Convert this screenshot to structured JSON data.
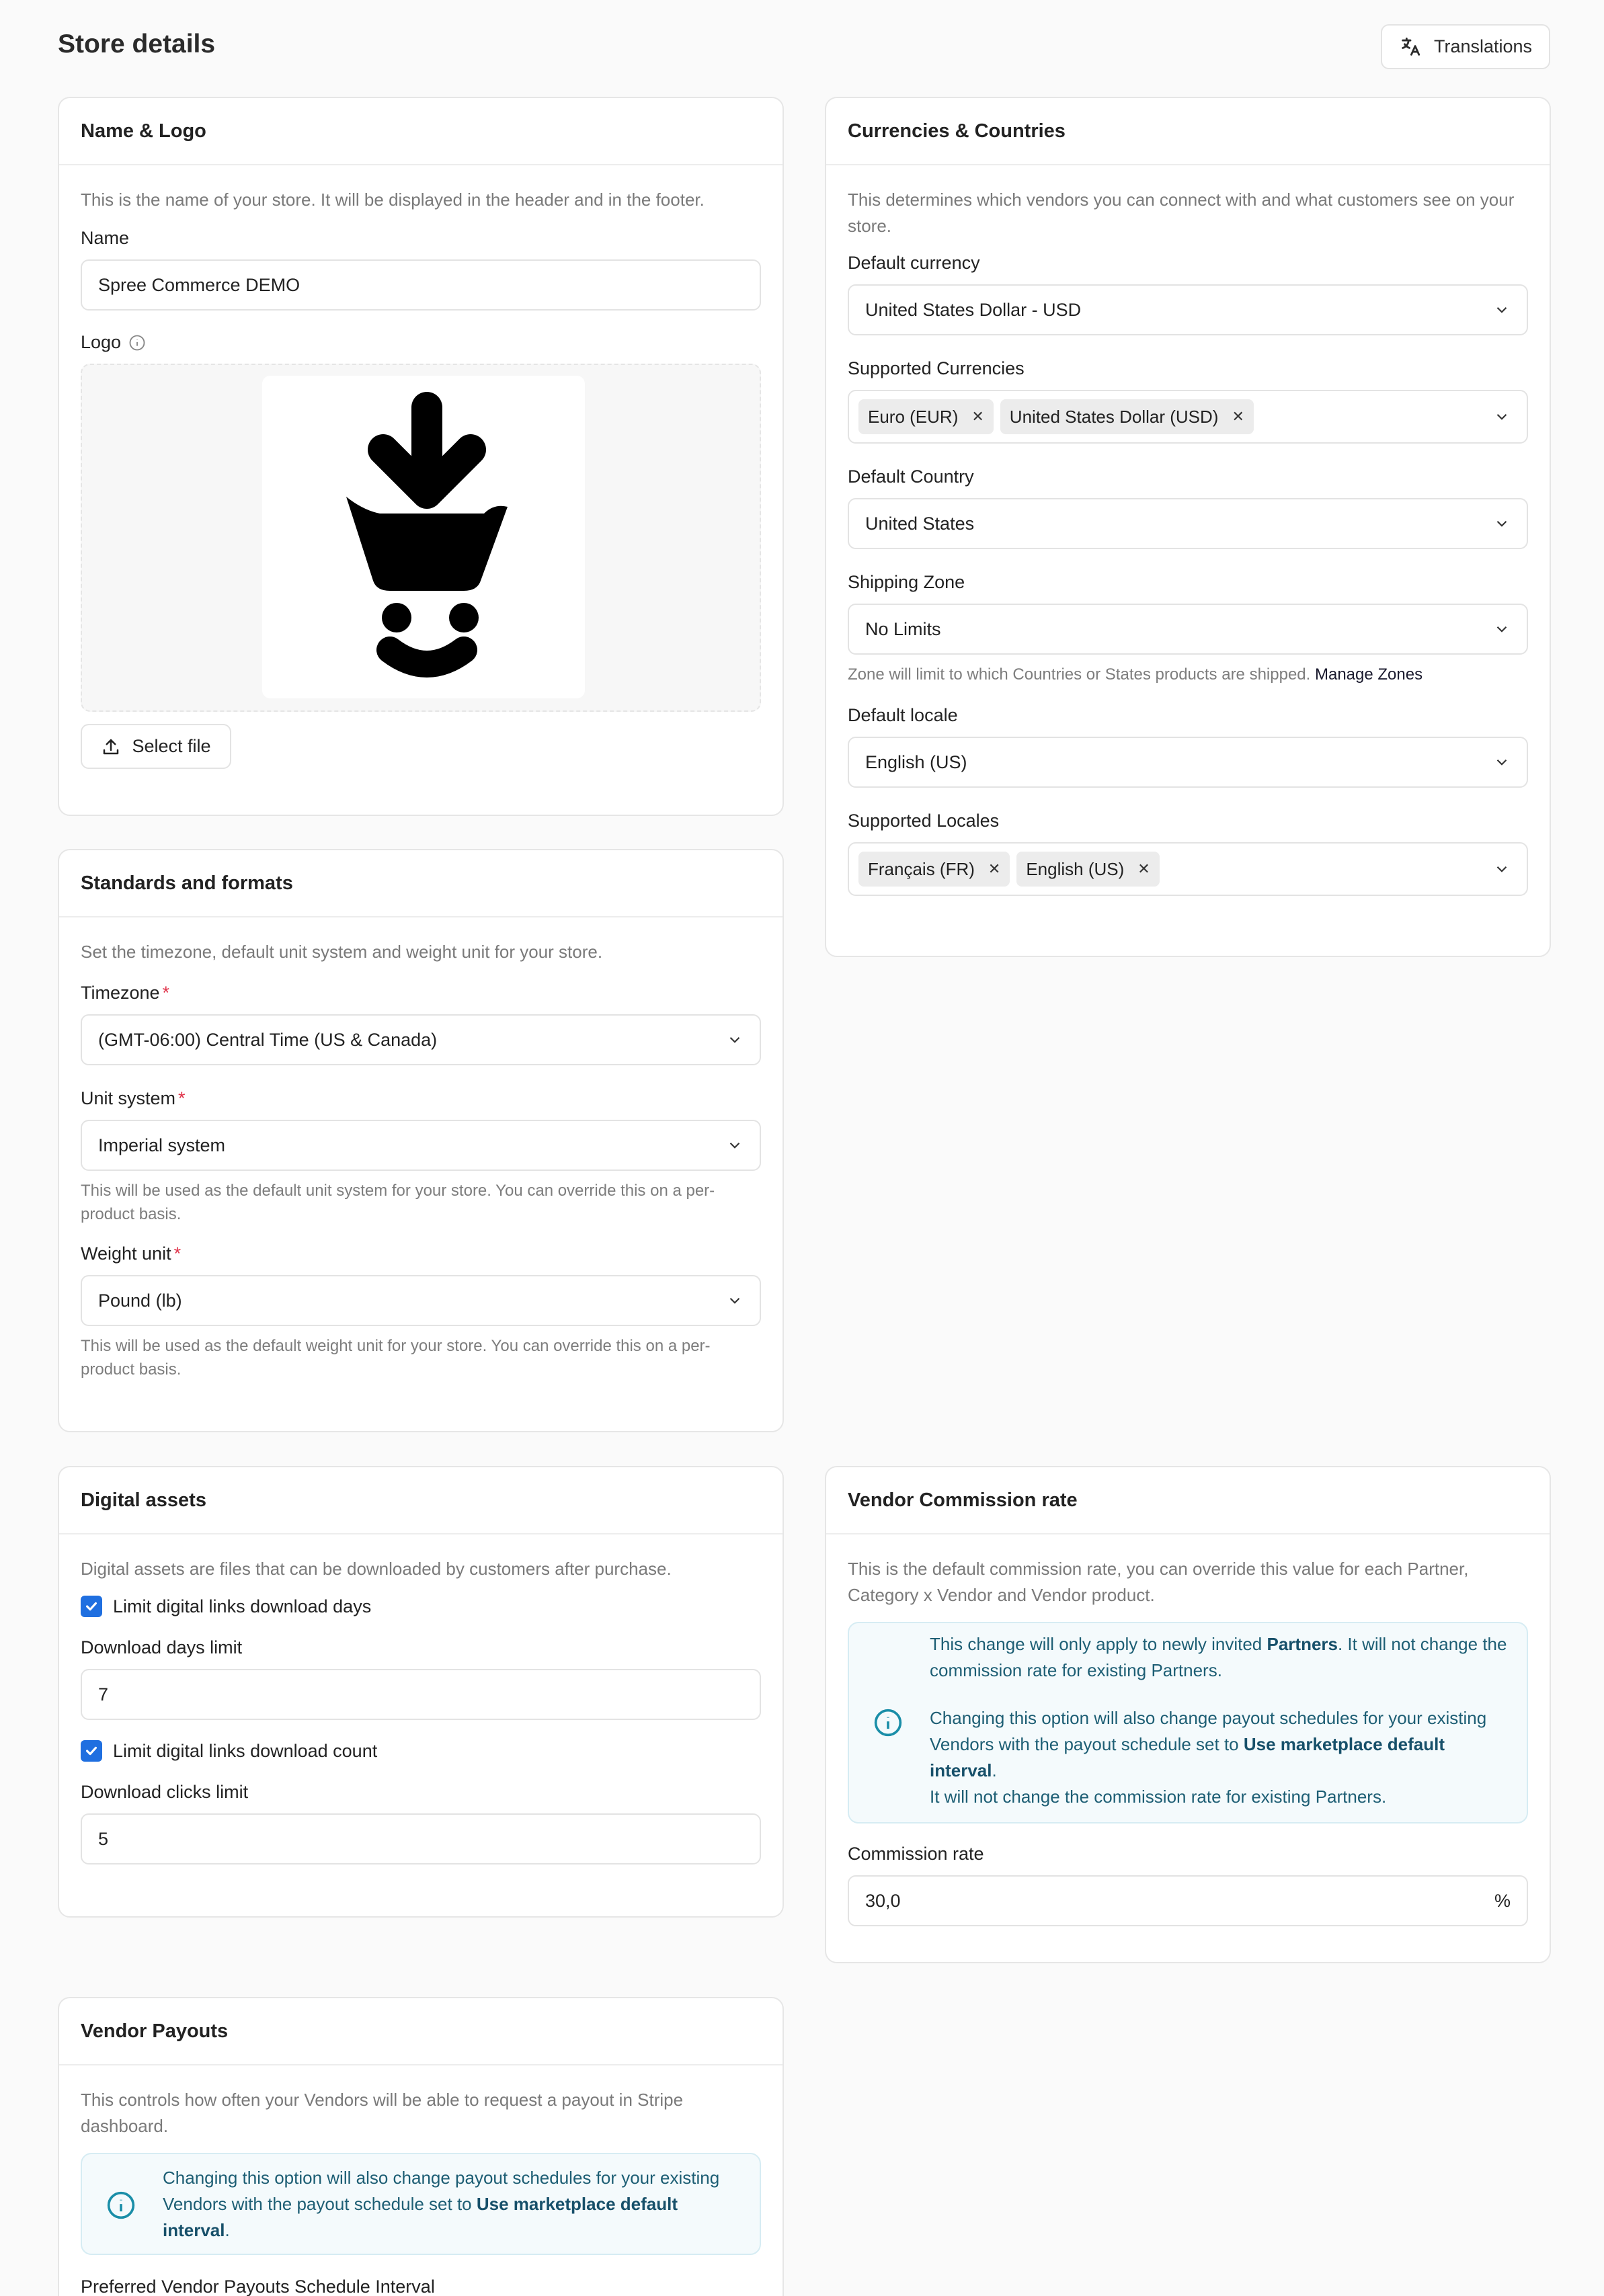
{
  "header": {
    "title": "Store details",
    "translations_label": "Translations"
  },
  "name_logo": {
    "title": "Name & Logo",
    "description": "This is the name of your store. It will be displayed in the header and in the footer.",
    "name_label": "Name",
    "name_value": "Spree Commerce DEMO",
    "logo_label": "Logo",
    "select_file_label": "Select file"
  },
  "currencies": {
    "title": "Currencies & Countries",
    "description": "This determines which vendors you can connect with and what customers see on your store.",
    "default_currency_label": "Default currency",
    "default_currency_value": "United States Dollar - USD",
    "supported_currencies_label": "Supported Currencies",
    "supported_currencies": [
      "Euro (EUR)",
      "United States Dollar (USD)"
    ],
    "default_country_label": "Default Country",
    "default_country_value": "United States",
    "shipping_zone_label": "Shipping Zone",
    "shipping_zone_value": "No Limits",
    "shipping_hint": "Zone will limit to which Countries or States products are shipped.",
    "manage_zones_label": "Manage Zones",
    "default_locale_label": "Default locale",
    "default_locale_value": "English (US)",
    "supported_locales_label": "Supported Locales",
    "supported_locales": [
      "Français (FR)",
      "English (US)"
    ]
  },
  "standards": {
    "title": "Standards and formats",
    "description": "Set the timezone, default unit system and weight unit for your store.",
    "timezone_label": "Timezone",
    "timezone_value": "(GMT-06:00) Central Time (US & Canada)",
    "unit_system_label": "Unit system",
    "unit_system_value": "Imperial system",
    "unit_system_hint": "This will be used as the default unit system for your store. You can override this on a per-product basis.",
    "weight_unit_label": "Weight unit",
    "weight_unit_value": "Pound (lb)",
    "weight_unit_hint": "This will be used as the default weight unit for your store. You can override this on a per-product basis.",
    "required_mark": "*"
  },
  "digital": {
    "title": "Digital assets",
    "description": "Digital assets are files that can be downloaded by customers after purchase.",
    "limit_days_label": "Limit digital links download days",
    "limit_days_checked": true,
    "days_limit_label": "Download days limit",
    "days_limit_value": "7",
    "limit_count_label": "Limit digital links download count",
    "limit_count_checked": true,
    "clicks_limit_label": "Download clicks limit",
    "clicks_limit_value": "5"
  },
  "commission": {
    "title": "Vendor Commission rate",
    "description": "This is the default commission rate, you can override this value for each Partner, Category x Vendor and Vendor product.",
    "info_p1_a": "This change will only apply to newly invited ",
    "info_p1_b": "Partners",
    "info_p1_c": ". It will not change the commission rate for existing Partners.",
    "info_p2_a": "Changing this option will also change payout schedules for your existing Vendors with the payout schedule set to ",
    "info_p2_b": "Use marketplace default interval",
    "info_p2_c": ".",
    "info_p3": "It will not change the commission rate for existing Partners.",
    "rate_label": "Commission rate",
    "rate_value": "30,0",
    "rate_unit": "%"
  },
  "payouts": {
    "title": "Vendor Payouts",
    "description": "This controls how often your Vendors will be able to request a payout in Stripe dashboard.",
    "info_a": "Changing this option will also change payout schedules for your existing Vendors with the payout schedule set to ",
    "info_b": "Use marketplace default interval",
    "info_c": ".",
    "interval_label": "Preferred Vendor Payouts Schedule Interval"
  }
}
